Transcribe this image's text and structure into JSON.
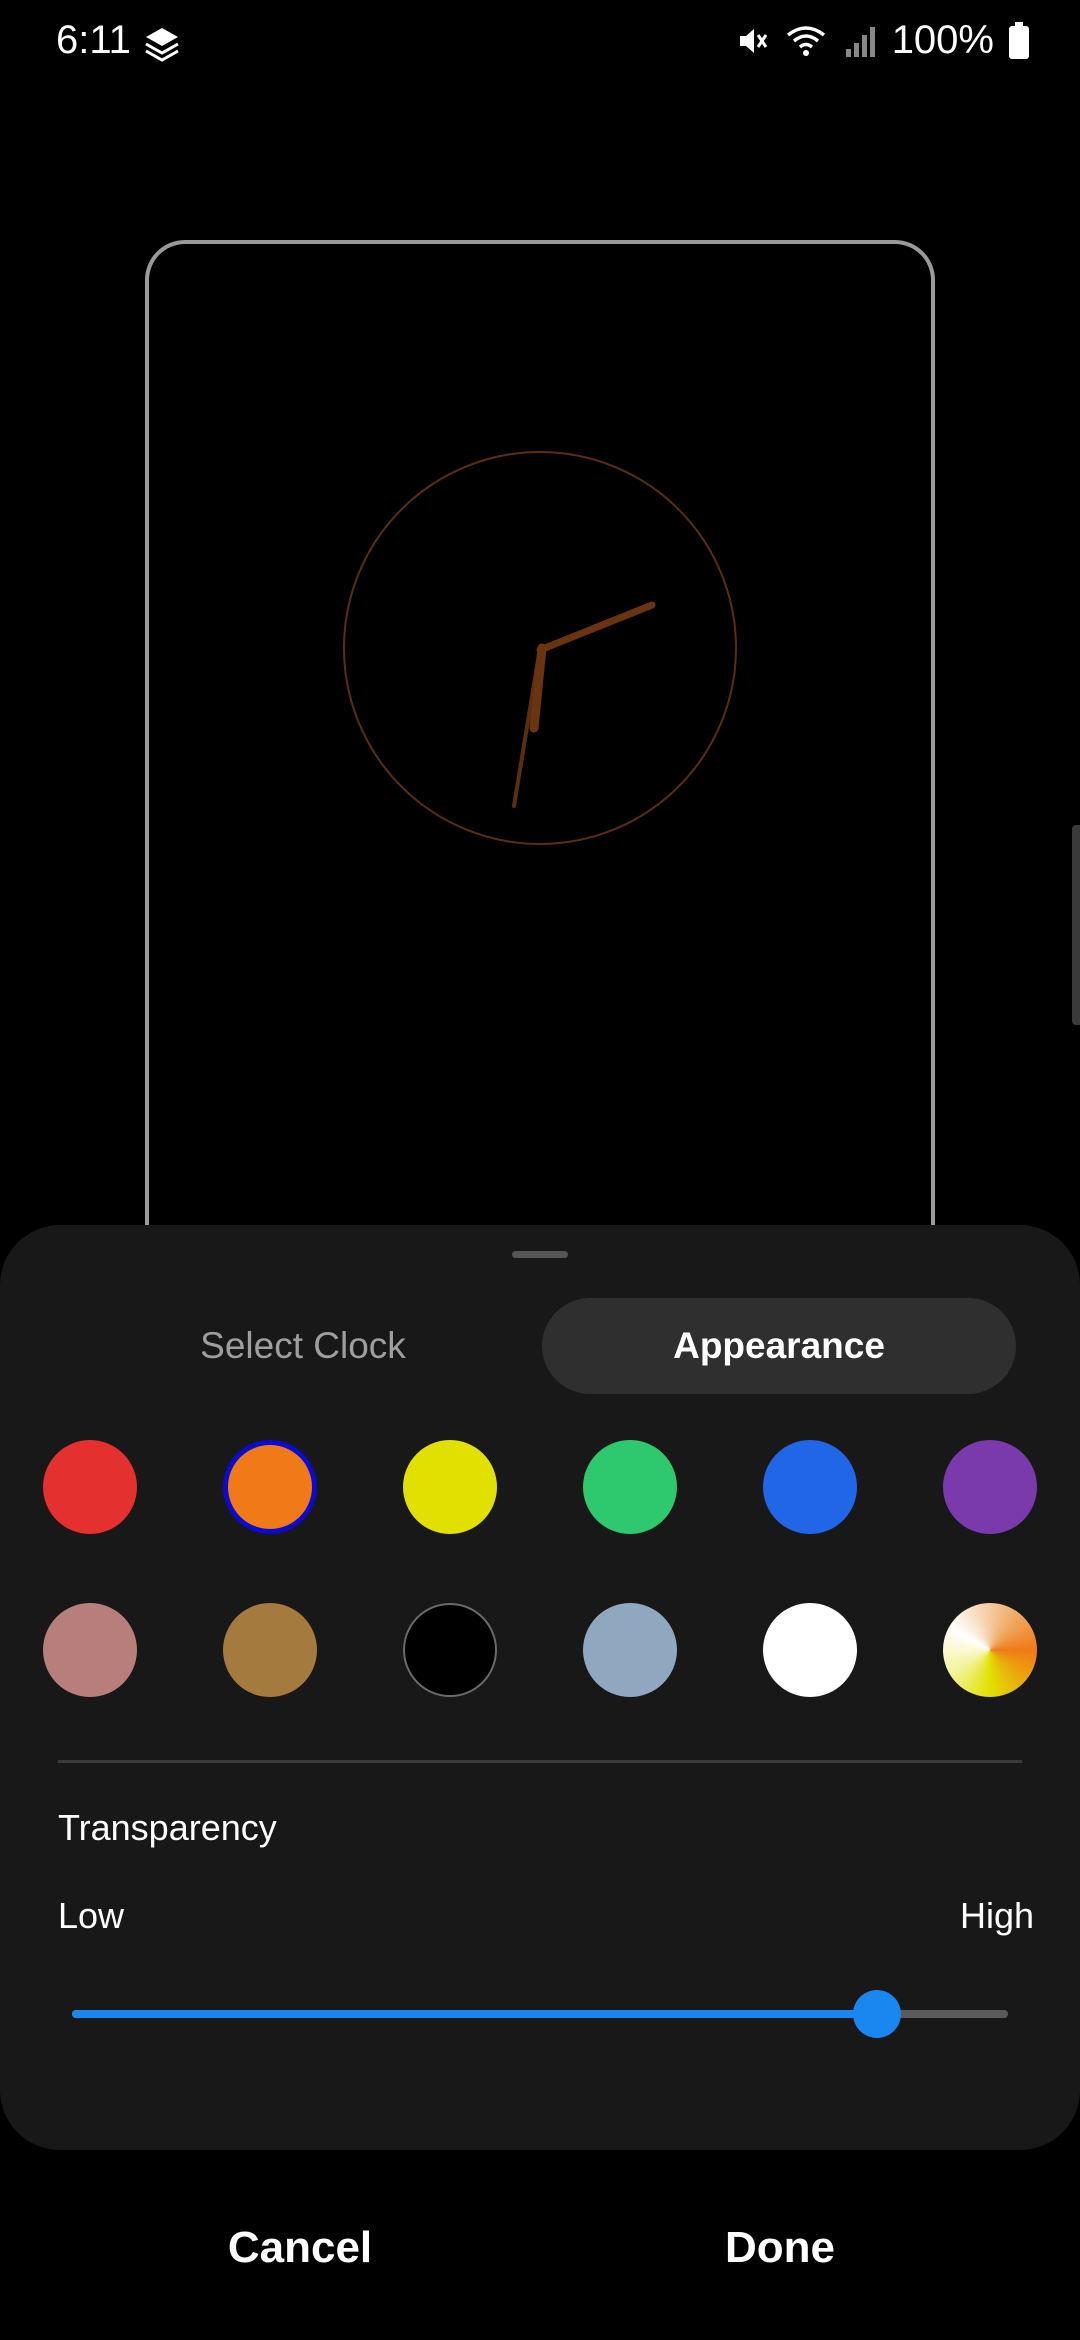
{
  "status_bar": {
    "time": "6:11",
    "battery": "100%",
    "icons": [
      "layers-icon",
      "mute-icon",
      "wifi-icon",
      "signal-icon",
      "battery-icon"
    ]
  },
  "clock_preview": {
    "ring_color": "#5a2e10",
    "hand_color": "#6b3410"
  },
  "tabs": {
    "select_clock": "Select Clock",
    "appearance": "Appearance",
    "active": "appearance"
  },
  "colors": {
    "selected": "orange",
    "swatches": [
      {
        "name": "red",
        "hex": "#e53030"
      },
      {
        "name": "orange",
        "hex": "#f07a18"
      },
      {
        "name": "yellow",
        "hex": "#e2e000"
      },
      {
        "name": "green",
        "hex": "#2ec86e"
      },
      {
        "name": "blue",
        "hex": "#2266e8"
      },
      {
        "name": "purple",
        "hex": "#7b3aab"
      },
      {
        "name": "rose",
        "hex": "#b87e7b"
      },
      {
        "name": "bronze",
        "hex": "#a57a3e"
      },
      {
        "name": "black",
        "hex": "#000000"
      },
      {
        "name": "slate-blue",
        "hex": "#8fa8c0"
      },
      {
        "name": "white",
        "hex": "#ffffff"
      },
      {
        "name": "custom-color",
        "hex": "gradient"
      }
    ]
  },
  "transparency": {
    "label": "Transparency",
    "low_label": "Low",
    "high_label": "High",
    "value_fraction": 0.86,
    "accent": "#1a86f0"
  },
  "actions": {
    "cancel": "Cancel",
    "done": "Done"
  }
}
